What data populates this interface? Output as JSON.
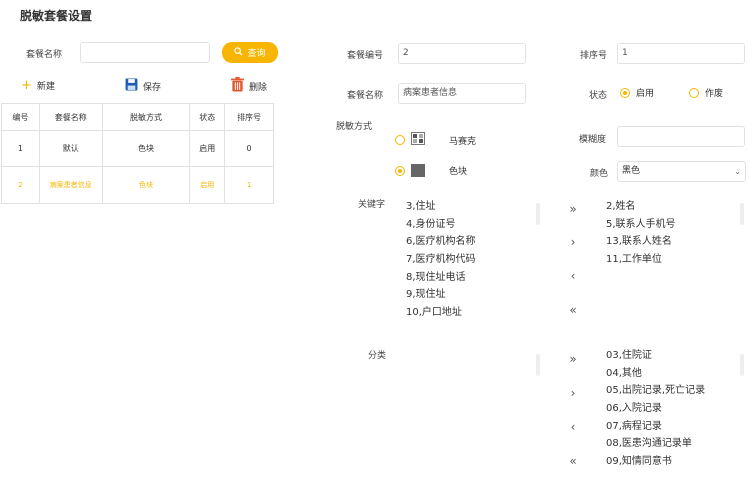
{
  "page": {
    "title": "脱敏套餐设置"
  },
  "search": {
    "label": "套餐名称",
    "value": "",
    "button_label": "查询"
  },
  "toolbar": {
    "new_label": "新建",
    "save_label": "保存",
    "delete_label": "删除"
  },
  "table": {
    "headers": [
      "编号",
      "套餐名称",
      "脱敏方式",
      "状态",
      "排序号"
    ],
    "rows": [
      [
        "1",
        "默认",
        "色块",
        "启用",
        "0"
      ],
      [
        "2",
        "病案患者信息",
        "色块",
        "启用",
        "1"
      ]
    ]
  },
  "form": {
    "code_label": "套餐编号",
    "code_value": "2",
    "sort_label": "排序号",
    "sort_value": "1",
    "name_label": "套餐名称",
    "name_value": "病案患者信息",
    "status_label": "状态",
    "status_enabled": "启用",
    "status_disabled": "作废",
    "method_label": "脱敏方式",
    "method_mosaic": "马赛克",
    "method_block": "色块",
    "blur_label": "模糊度",
    "blur_value": "",
    "color_label": "颜色",
    "color_value": "黑色",
    "keyword_label": "关键字",
    "category_label": "分类"
  },
  "keywords": {
    "available": [
      "3,住址",
      "4,身份证号",
      "6,医疗机构名称",
      "7,医疗机构代码",
      "8,现住址电话",
      "9,现住址",
      "10,户口地址"
    ],
    "selected": [
      "2,姓名",
      "5,联系人手机号",
      "13,联系人姓名",
      "11,工作单位"
    ]
  },
  "categories": {
    "available": [],
    "selected": [
      "03,住院证",
      "04,其他",
      "05,出院记录,死亡记录",
      "06,入院记录",
      "07,病程记录",
      "08,医患沟通记录单",
      "09,知情同意书"
    ]
  },
  "arrows": {
    "all_right": "»",
    "right": "›",
    "left": "‹",
    "all_left": "«"
  },
  "colors": {
    "accent": "#f7b500",
    "border": "#e2e2e2",
    "save_icon": "#1e5fb3",
    "delete_icon": "#e2572e"
  }
}
